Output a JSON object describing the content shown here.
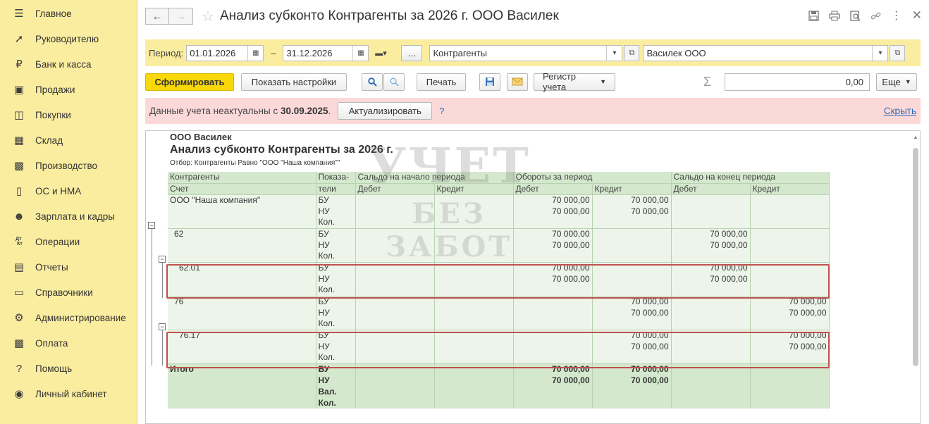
{
  "sidebar": {
    "items": [
      {
        "label": "Главное",
        "icon": "menu-icon"
      },
      {
        "label": "Руководителю",
        "icon": "trend-icon"
      },
      {
        "label": "Банк и касса",
        "icon": "ruble-icon"
      },
      {
        "label": "Продажи",
        "icon": "bag-icon"
      },
      {
        "label": "Покупки",
        "icon": "cart-icon"
      },
      {
        "label": "Склад",
        "icon": "warehouse-icon"
      },
      {
        "label": "Производство",
        "icon": "factory-icon"
      },
      {
        "label": "ОС и НМА",
        "icon": "truck-icon"
      },
      {
        "label": "Зарплата и кадры",
        "icon": "person-icon"
      },
      {
        "label": "Операции",
        "icon": "dt-kt-icon"
      },
      {
        "label": "Отчеты",
        "icon": "bar-chart-icon"
      },
      {
        "label": "Справочники",
        "icon": "book-icon"
      },
      {
        "label": "Администрирование",
        "icon": "gear-icon"
      },
      {
        "label": "Оплата",
        "icon": "payment-icon"
      },
      {
        "label": "Помощь",
        "icon": "question-icon"
      },
      {
        "label": "Личный кабинет",
        "icon": "user-circle-icon"
      }
    ]
  },
  "header": {
    "title": "Анализ субконто Контрагенты за 2026 г. ООО Василек"
  },
  "period": {
    "label": "Период:",
    "from": "01.01.2026",
    "dash": "–",
    "to": "31.12.2026",
    "dots": "...",
    "subconto": "Контрагенты",
    "organization": "Василек ООО"
  },
  "toolbar": {
    "generate": "Сформировать",
    "show_settings": "Показать настройки",
    "print": "Печать",
    "register": "Регистр учета",
    "sum_symbol": "Σ",
    "sum_value": "0,00",
    "more": "Еще"
  },
  "warning": {
    "text": "Данные учета неактуальны с ",
    "date": "30.09.2025",
    "dot": ".",
    "actualize": "Актуализировать",
    "help": "?",
    "hide": "Скрыть"
  },
  "report": {
    "org": "ООО Василек",
    "title": "Анализ субконто Контрагенты за 2026 г.",
    "filter": "Отбор: Контрагенты Равно \"ООО \"Наша компания\"\"",
    "headers": {
      "col1_top": "Контрагенты",
      "col1_bottom": "Счет",
      "col2_top": "Показа-",
      "col2_bottom": "тели",
      "open_balance": "Сальдо на начало периода",
      "turnover": "Обороты за период",
      "close_balance": "Сальдо на конец периода",
      "debit": "Дебет",
      "credit": "Кредит"
    },
    "rows": [
      {
        "name": "ООО \"Наша компания\"",
        "ind": "БУ",
        "c3": "",
        "c4": "",
        "c5": "70 000,00",
        "c6": "70 000,00",
        "c7": "",
        "c8": ""
      },
      {
        "name": "",
        "ind": "НУ",
        "c3": "",
        "c4": "",
        "c5": "70 000,00",
        "c6": "70 000,00",
        "c7": "",
        "c8": ""
      },
      {
        "name": "",
        "ind": "Кол.",
        "c3": "",
        "c4": "",
        "c5": "",
        "c6": "",
        "c7": "",
        "c8": ""
      },
      {
        "name": "62",
        "ind": "БУ",
        "c3": "",
        "c4": "",
        "c5": "70 000,00",
        "c6": "",
        "c7": "70 000,00",
        "c8": ""
      },
      {
        "name": "",
        "ind": "НУ",
        "c3": "",
        "c4": "",
        "c5": "70 000,00",
        "c6": "",
        "c7": "70 000,00",
        "c8": ""
      },
      {
        "name": "",
        "ind": "Кол.",
        "c3": "",
        "c4": "",
        "c5": "",
        "c6": "",
        "c7": "",
        "c8": ""
      },
      {
        "name": "62.01",
        "ind": "БУ",
        "c3": "",
        "c4": "",
        "c5": "70 000,00",
        "c6": "",
        "c7": "70 000,00",
        "c8": ""
      },
      {
        "name": "",
        "ind": "НУ",
        "c3": "",
        "c4": "",
        "c5": "70 000,00",
        "c6": "",
        "c7": "70 000,00",
        "c8": ""
      },
      {
        "name": "",
        "ind": "Кол.",
        "c3": "",
        "c4": "",
        "c5": "",
        "c6": "",
        "c7": "",
        "c8": ""
      },
      {
        "name": "76",
        "ind": "БУ",
        "c3": "",
        "c4": "",
        "c5": "",
        "c6": "70 000,00",
        "c7": "",
        "c8": "70 000,00"
      },
      {
        "name": "",
        "ind": "НУ",
        "c3": "",
        "c4": "",
        "c5": "",
        "c6": "70 000,00",
        "c7": "",
        "c8": "70 000,00"
      },
      {
        "name": "",
        "ind": "Кол.",
        "c3": "",
        "c4": "",
        "c5": "",
        "c6": "",
        "c7": "",
        "c8": ""
      },
      {
        "name": "76.17",
        "ind": "БУ",
        "c3": "",
        "c4": "",
        "c5": "",
        "c6": "70 000,00",
        "c7": "",
        "c8": "70 000,00"
      },
      {
        "name": "",
        "ind": "НУ",
        "c3": "",
        "c4": "",
        "c5": "",
        "c6": "70 000,00",
        "c7": "",
        "c8": "70 000,00"
      },
      {
        "name": "",
        "ind": "Кол.",
        "c3": "",
        "c4": "",
        "c5": "",
        "c6": "",
        "c7": "",
        "c8": ""
      }
    ],
    "totals": [
      {
        "name": "Итого",
        "ind": "БУ",
        "c5": "70 000,00",
        "c6": "70 000,00"
      },
      {
        "name": "",
        "ind": "НУ",
        "c5": "70 000,00",
        "c6": "70 000,00"
      },
      {
        "name": "",
        "ind": "Вал.",
        "c5": "",
        "c6": ""
      },
      {
        "name": "",
        "ind": "Кол.",
        "c5": "",
        "c6": ""
      }
    ],
    "watermark_line1": "УЧЕТ",
    "watermark_line2": "БЕЗ ЗАБОТ",
    "highlight_color": "#c0504d"
  },
  "colors": {
    "sidebar_bg": "#fbeda0",
    "primary_button": "#f8d808",
    "warning_bg": "#fcd9d9",
    "table_header": "#d3e8cc",
    "table_row": "#edf5ea"
  }
}
